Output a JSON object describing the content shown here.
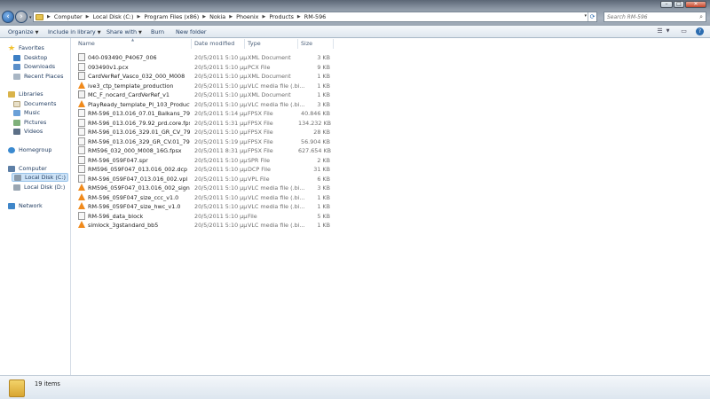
{
  "window": {
    "controls": {
      "minimize": "–",
      "maximize": "□",
      "close": "✕"
    }
  },
  "address": {
    "crumbs": [
      "Computer",
      "Local Disk (C:)",
      "Program Files (x86)",
      "Nokia",
      "Phoenix",
      "Products",
      "RM-596"
    ]
  },
  "search": {
    "placeholder": "Search RM-596"
  },
  "toolbar": {
    "organize": "Organize",
    "include_in_library": "Include in library",
    "share_with": "Share with",
    "burn": "Burn",
    "new_folder": "New folder"
  },
  "nav": {
    "favorites": "Favorites",
    "desktop": "Desktop",
    "downloads": "Downloads",
    "recent_places": "Recent Places",
    "libraries": "Libraries",
    "documents": "Documents",
    "music": "Music",
    "pictures": "Pictures",
    "videos": "Videos",
    "homegroup": "Homegroup",
    "computer": "Computer",
    "local_disk_c": "Local Disk (C:)",
    "local_disk_d": "Local Disk (D:)",
    "network": "Network"
  },
  "columns": {
    "name": "Name",
    "date": "Date modified",
    "type": "Type",
    "size": "Size"
  },
  "files": [
    {
      "name": "040-093490_P4067_006",
      "date": "20/5/2011 5:10 μμ",
      "type": "XML Document",
      "size": "3 KB",
      "icon": "xml"
    },
    {
      "name": "093490v1.pcx",
      "date": "20/5/2011 5:10 μμ",
      "type": "PCX File",
      "size": "9 KB",
      "icon": "generic"
    },
    {
      "name": "CardVerRef_Vasco_032_000_M008",
      "date": "20/5/2011 5:10 μμ",
      "type": "XML Document",
      "size": "1 KB",
      "icon": "xml"
    },
    {
      "name": "ive3_ctp_template_production",
      "date": "20/5/2011 5:10 μμ",
      "type": "VLC media file (.bi...",
      "size": "1 KB",
      "icon": "vlc"
    },
    {
      "name": "MC_F_nocard_CardVerRef_v1",
      "date": "20/5/2011 5:10 μμ",
      "type": "XML Document",
      "size": "1 KB",
      "icon": "xml"
    },
    {
      "name": "PlayReady_template_PI_103_Production_...",
      "date": "20/5/2011 5:10 μμ",
      "type": "VLC media file (.bi...",
      "size": "3 KB",
      "icon": "vlc"
    },
    {
      "name": "RM-596_013.016_07.01_Balkans_79.92_prd...",
      "date": "20/5/2011 5:14 μμ",
      "type": "FPSX File",
      "size": "40.846 KB",
      "icon": "generic"
    },
    {
      "name": "RM-596_013.016_79.92_prd.core.fpsx",
      "date": "20/5/2011 5:31 μμ",
      "type": "FPSX File",
      "size": "134.232 KB",
      "icon": "generic"
    },
    {
      "name": "RM-596_013.016_329.01_GR_CV_79.92_pr...",
      "date": "20/5/2011 5:10 μμ",
      "type": "FPSX File",
      "size": "28 KB",
      "icon": "generic"
    },
    {
      "name": "RM-596_013.016_329_GR_CV.01_79.92_pr...",
      "date": "20/5/2011 5:19 μμ",
      "type": "FPSX File",
      "size": "56.904 KB",
      "icon": "generic"
    },
    {
      "name": "RM596_032_000_M008_16G.fpsx",
      "date": "20/5/2011 8:31 μμ",
      "type": "FPSX File",
      "size": "627.654 KB",
      "icon": "generic"
    },
    {
      "name": "RM-596_059F047.spr",
      "date": "20/5/2011 5:10 μμ",
      "type": "SPR File",
      "size": "2 KB",
      "icon": "generic"
    },
    {
      "name": "RM596_059F047_013.016_002.dcp",
      "date": "20/5/2011 5:10 μμ",
      "type": "DCP File",
      "size": "31 KB",
      "icon": "generic"
    },
    {
      "name": "RM-596_059F047_013.016_002.vpl",
      "date": "20/5/2011 5:10 μμ",
      "type": "VPL File",
      "size": "6 KB",
      "icon": "generic"
    },
    {
      "name": "RM596_059F047_013.016_002_signature",
      "date": "20/5/2011 5:10 μμ",
      "type": "VLC media file (.bi...",
      "size": "3 KB",
      "icon": "vlc"
    },
    {
      "name": "RM-596_059F047_size_ccc_v1.0",
      "date": "20/5/2011 5:10 μμ",
      "type": "VLC media file (.bi...",
      "size": "1 KB",
      "icon": "vlc"
    },
    {
      "name": "RM-596_059F047_size_hwc_v1.0",
      "date": "20/5/2011 5:10 μμ",
      "type": "VLC media file (.bi...",
      "size": "1 KB",
      "icon": "vlc"
    },
    {
      "name": "RM-596_data_block",
      "date": "20/5/2011 5:10 μμ",
      "type": "File",
      "size": "5 KB",
      "icon": "generic"
    },
    {
      "name": "simlock_3gstandard_bb5",
      "date": "20/5/2011 5:10 μμ",
      "type": "VLC media file (.bi...",
      "size": "1 KB",
      "icon": "vlc"
    }
  ],
  "details": {
    "item_count": "19 items"
  },
  "icons": {
    "back": "back-arrow-icon",
    "forward": "forward-arrow-icon",
    "refresh": "refresh-icon",
    "search": "search-icon",
    "folder": "folder-icon",
    "help": "help-icon"
  }
}
